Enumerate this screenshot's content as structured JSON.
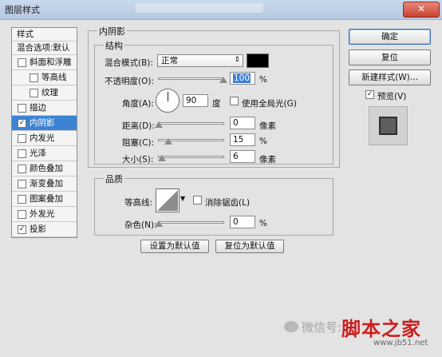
{
  "window": {
    "title": "图层样式",
    "close_icon": "close-icon"
  },
  "style_list": {
    "header": "样式",
    "blend_default": "混合选项:默认",
    "items": [
      {
        "label": "斜面和浮雕",
        "checked": false,
        "indent": false
      },
      {
        "label": "等高线",
        "checked": false,
        "indent": true
      },
      {
        "label": "纹理",
        "checked": false,
        "indent": true
      },
      {
        "label": "描边",
        "checked": false,
        "indent": false
      },
      {
        "label": "内阴影",
        "checked": true,
        "indent": false,
        "selected": true
      },
      {
        "label": "内发光",
        "checked": false,
        "indent": false
      },
      {
        "label": "光泽",
        "checked": false,
        "indent": false
      },
      {
        "label": "颜色叠加",
        "checked": false,
        "indent": false
      },
      {
        "label": "渐变叠加",
        "checked": false,
        "indent": false
      },
      {
        "label": "图案叠加",
        "checked": false,
        "indent": false
      },
      {
        "label": "外发光",
        "checked": false,
        "indent": false
      },
      {
        "label": "投影",
        "checked": true,
        "indent": false
      }
    ]
  },
  "inner_shadow": {
    "title": "内阴影",
    "structure": {
      "title": "结构",
      "blend_mode_label": "混合模式(B):",
      "blend_mode_value": "正常",
      "shadow_color": "#000000",
      "opacity_label": "不透明度(O):",
      "opacity_value": "100",
      "opacity_unit": "%",
      "angle_label": "角度(A):",
      "angle_value": "90",
      "angle_unit": "度",
      "global_light_label": "使用全局光(G)",
      "global_light_checked": false,
      "distance_label": "距离(D):",
      "distance_value": "0",
      "distance_unit": "像素",
      "choke_label": "阻塞(C):",
      "choke_value": "15",
      "choke_unit": "%",
      "size_label": "大小(S):",
      "size_value": "6",
      "size_unit": "像素"
    },
    "quality": {
      "title": "品质",
      "contour_label": "等高线:",
      "anti_alias_label": "消除锯齿(L)",
      "anti_alias_checked": false,
      "noise_label": "杂色(N):",
      "noise_value": "0",
      "noise_unit": "%"
    },
    "set_default_label": "设置为默认值",
    "reset_default_label": "复位为默认值"
  },
  "buttons": {
    "ok": "确定",
    "reset": "复位",
    "new_style": "新建样式(W)...",
    "preview_label": "预览(V)",
    "preview_checked": true
  },
  "watermark": {
    "text": "微信号:",
    "brand": "脚本之家",
    "url": "www.jb51.net"
  },
  "colors": {
    "selection": "#3c84d3",
    "titlebar": "#b6c8e1",
    "close": "#c9422f"
  }
}
